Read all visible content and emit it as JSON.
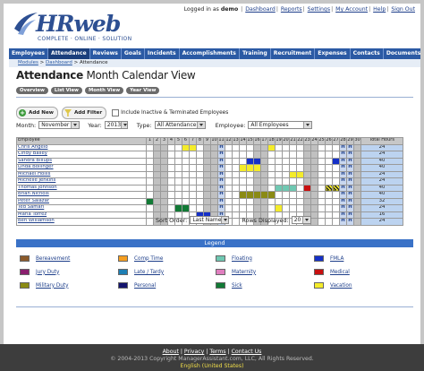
{
  "brand": {
    "name": "HRweb",
    "tagline": "COMPLETE · ONLINE · SOLUTION"
  },
  "toplinks": {
    "logged_in_prefix": "Logged in as",
    "user": "demo",
    "items": [
      "Dashboard",
      "Reports",
      "Settings",
      "My Account",
      "Help",
      "Sign Out"
    ]
  },
  "nav": {
    "tabs": [
      "Employees",
      "Attendance",
      "Reviews",
      "Goals",
      "Incidents",
      "Accomplishments",
      "Training",
      "Recruitment",
      "Expenses",
      "Contacts",
      "Documents"
    ],
    "active": "Attendance"
  },
  "breadcrumb": {
    "items": [
      "Modules",
      "Dashboard"
    ],
    "current": "Attendance"
  },
  "page": {
    "title_bold": "Attendance",
    "title_rest": " Month Calendar View"
  },
  "view_buttons": [
    "Overview",
    "List View",
    "Month View",
    "Year View"
  ],
  "actions": {
    "add_new": "Add New",
    "add_filter": "Add Filter",
    "include_label": "Include Inactive & Terminated Employees"
  },
  "filters": {
    "month_label": "Month:",
    "month_value": "November",
    "year_label": "Year:",
    "year_value": "2013",
    "type_label": "Type:",
    "type_value": "All Attendance",
    "employee_label": "Employee:",
    "employee_value": "All Employees"
  },
  "calendar": {
    "employee_header": "Employee",
    "total_header": "Total Hours",
    "days": [
      1,
      2,
      3,
      4,
      5,
      6,
      7,
      8,
      9,
      10,
      11,
      12,
      13,
      14,
      15,
      16,
      17,
      18,
      19,
      20,
      21,
      22,
      23,
      24,
      25,
      26,
      27,
      28,
      29,
      30
    ],
    "weekend_days": [
      2,
      3,
      9,
      10,
      16,
      17,
      23,
      24,
      30
    ],
    "holiday_days": [
      11,
      28,
      29
    ],
    "holiday_mark": "H",
    "colors": {
      "bereavement": "#8b5a2b",
      "comp_time": "#f59e20",
      "floating": "#6fc8b2",
      "fmla": "#1530c8",
      "jury_duty": "#8a1f6e",
      "late_tardy": "#1e7fb4",
      "maternity": "#e07fbf",
      "medical": "#c81010",
      "military_duty": "#8a8a14",
      "personal": "#14146e",
      "sick": "#117a35",
      "vacation": "#f4ec2a"
    },
    "rows": [
      {
        "name": "Chris Angelo",
        "total": "24",
        "marks": [
          {
            "day": 6,
            "type": "vacation"
          },
          {
            "day": 7,
            "type": "vacation"
          },
          {
            "day": 18,
            "type": "vacation"
          }
        ]
      },
      {
        "name": "Cindy Bailey",
        "total": "24",
        "marks": []
      },
      {
        "name": "Sandra Billups",
        "total": "40",
        "marks": [
          {
            "day": 15,
            "type": "fmla"
          },
          {
            "day": 16,
            "type": "fmla"
          },
          {
            "day": 27,
            "type": "fmla"
          }
        ]
      },
      {
        "name": "Linda Bollinger",
        "total": "40",
        "marks": [
          {
            "day": 14,
            "type": "vacation"
          },
          {
            "day": 15,
            "type": "vacation"
          },
          {
            "day": 16,
            "type": "vacation"
          }
        ]
      },
      {
        "name": "Michael Hollis",
        "total": "24",
        "marks": [
          {
            "day": 21,
            "type": "vacation"
          },
          {
            "day": 22,
            "type": "vacation"
          }
        ]
      },
      {
        "name": "Michelle Jenkins",
        "total": "24",
        "marks": []
      },
      {
        "name": "Thomas Johnson",
        "total": "40",
        "marks": [
          {
            "day": 19,
            "type": "floating"
          },
          {
            "day": 20,
            "type": "floating"
          },
          {
            "day": 21,
            "type": "floating"
          },
          {
            "day": 23,
            "type": "medical"
          },
          {
            "day": 26,
            "type": "hatch"
          },
          {
            "day": 27,
            "type": "hatch"
          }
        ]
      },
      {
        "name": "Brian Nichols",
        "total": "40",
        "marks": [
          {
            "day": 14,
            "type": "military_duty"
          },
          {
            "day": 15,
            "type": "military_duty"
          },
          {
            "day": 16,
            "type": "military_duty"
          },
          {
            "day": 17,
            "type": "military_duty"
          },
          {
            "day": 18,
            "type": "military_duty"
          }
        ]
      },
      {
        "name": "Peter Salazar",
        "total": "32",
        "marks": [
          {
            "day": 1,
            "type": "sick"
          }
        ]
      },
      {
        "name": "Ted Samari",
        "total": "24",
        "marks": [
          {
            "day": 5,
            "type": "sick"
          },
          {
            "day": 6,
            "type": "sick"
          },
          {
            "day": 19,
            "type": "vacation"
          }
        ]
      },
      {
        "name": "Maria Torrez",
        "total": "16",
        "marks": [
          {
            "day": 8,
            "type": "fmla"
          },
          {
            "day": 9,
            "type": "fmla"
          }
        ]
      },
      {
        "name": "Ben Williamson",
        "total": "24",
        "marks": []
      }
    ]
  },
  "sort": {
    "sort_label": "Sort Order:",
    "sort_value": "Last Name",
    "rows_label": "Rows Displayed:",
    "rows_value": "20"
  },
  "legend": {
    "title": "Legend",
    "items": [
      {
        "label": "Bereavement",
        "color": "#8b5a2b"
      },
      {
        "label": "Comp Time",
        "color": "#f59e20"
      },
      {
        "label": "Floating",
        "color": "#6fc8b2"
      },
      {
        "label": "FMLA",
        "color": "#1530c8"
      },
      {
        "label": "Jury Duty",
        "color": "#8a1f6e"
      },
      {
        "label": "Late / Tardy",
        "color": "#1e7fb4"
      },
      {
        "label": "Maternity",
        "color": "#e07fbf"
      },
      {
        "label": "Medical",
        "color": "#c81010"
      },
      {
        "label": "Military Duty",
        "color": "#8a8a14"
      },
      {
        "label": "Personal",
        "color": "#14146e"
      },
      {
        "label": "Sick",
        "color": "#117a35"
      },
      {
        "label": "Vacation",
        "color": "#f4ec2a"
      }
    ]
  },
  "footer": {
    "links": [
      "About",
      "Privacy",
      "Terms",
      "Contact Us"
    ],
    "copyright": "© 2004-2013 Copyright ManagerAssistant.com, LLC, All Rights Reserved.",
    "language": "English (United States)"
  }
}
